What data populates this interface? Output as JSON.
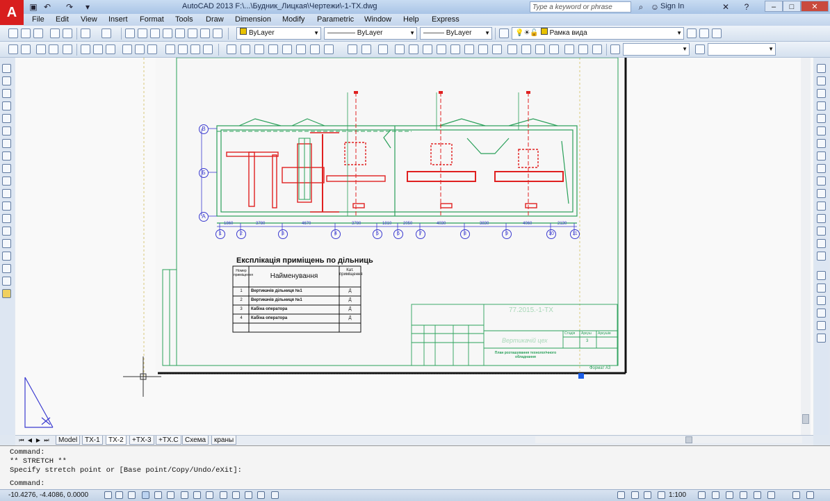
{
  "app": {
    "logo": "A",
    "title": "AutoCAD 2013  F:\\...\\Будник_Лицкая\\Чертежи\\-1-TX.dwg",
    "search_placeholder": "Type a keyword or phrase",
    "signin": "Sign In"
  },
  "menu": [
    "File",
    "Edit",
    "View",
    "Insert",
    "Format",
    "Tools",
    "Draw",
    "Dimension",
    "Modify",
    "Parametric",
    "Window",
    "Help",
    "Express"
  ],
  "properties": {
    "layer": "ByLayer",
    "linetype": "ByLayer",
    "lineweight": "ByLayer",
    "layer_name": "Рамка вида"
  },
  "drawing": {
    "axis_rows": [
      "В",
      "Б",
      "А"
    ],
    "axis_cols": [
      "1",
      "2",
      "3",
      "4",
      "5",
      "6",
      "7",
      "8",
      "9",
      "10",
      "11"
    ],
    "dims": [
      "1860",
      "3780",
      "4670",
      "3780",
      "1810",
      "2050",
      "4030",
      "3830",
      "4060",
      "2130"
    ],
    "schedule": {
      "title": "Експлікація приміщень по дільниць",
      "headers": [
        "Номер приміщення",
        "Найменування",
        "Кат. приміщення"
      ],
      "rows": [
        [
          "1",
          "Вертикачів дільниця №1",
          "Д"
        ],
        [
          "2",
          "Вертикачів дільниця №1",
          "Д"
        ],
        [
          "3",
          "Кабіна оператора",
          "Д"
        ],
        [
          "4",
          "Кабіна оператора",
          "Д"
        ]
      ]
    },
    "stamp": {
      "code": "77.2015.-1-ТХ",
      "sheet_title": "Вертикачій цех",
      "plan_title": "План розташування технологічного обладнання",
      "format": "Формат А3",
      "stage": "Стадія",
      "sheet": "Аркуш",
      "sheets": "Аркушів",
      "sheet_num": "3"
    }
  },
  "layout_tabs": [
    "Model",
    "TX-1",
    "TX-2",
    "+TX-3",
    "+TX.C",
    "Схема",
    "краны"
  ],
  "active_tab": "TX-2",
  "command": {
    "line1": "Command:",
    "line2": "** STRETCH **",
    "line3": "Specify stretch point or [Base point/Copy/Undo/eXit]:",
    "prompt": "Command:"
  },
  "status": {
    "coords": "-10.4276, -4.4086, 0.0000",
    "scale": "1:100"
  },
  "colors": {
    "accent": "#d81e1e",
    "plan_line": "#2aa05a",
    "equipment": "#e02020",
    "axis": "#3a3ad0"
  }
}
